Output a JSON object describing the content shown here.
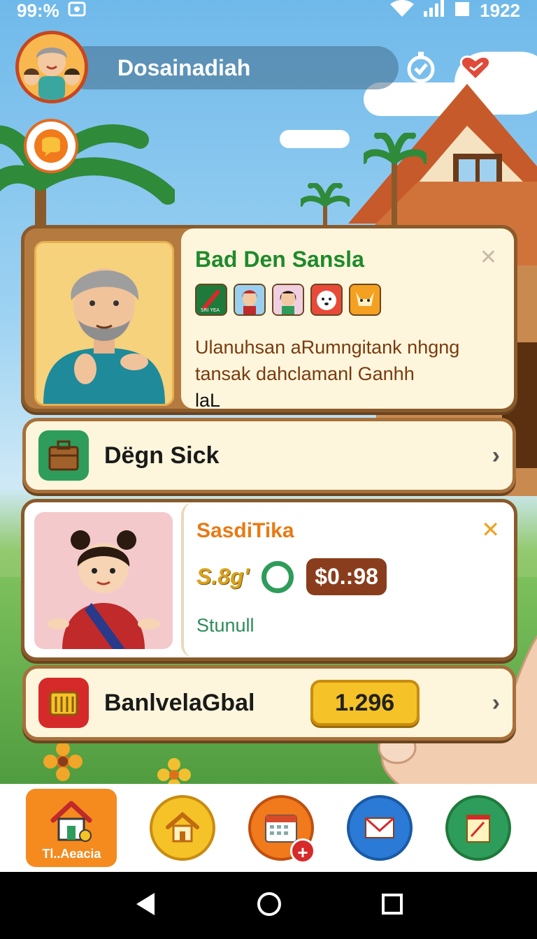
{
  "status_bar": {
    "battery": "99:%",
    "time": "1922"
  },
  "header": {
    "username": "Dosainadiah"
  },
  "card_one": {
    "title": "Bad Den Sansla",
    "description_line1": "Ulanuhsan aRumngitank nhgng",
    "description_line2": "tansak dahclamanl Ganhh",
    "description_line3": "laL",
    "chips": [
      "chip-paint-icon",
      "chip-woman-red-icon",
      "chip-woman-green-icon",
      "chip-dog-icon",
      "chip-fox-icon"
    ],
    "chip_text": "SRI YEA"
  },
  "row_two": {
    "label": "Dëgn Sick"
  },
  "card_three": {
    "title": "SasdiTika",
    "stat": "S.8g'",
    "price": "$0.:98",
    "subtitle": "Stunull"
  },
  "row_four": {
    "label": "BanlvelaGbal",
    "value": "1.296"
  },
  "bottom_nav": {
    "active_label": "Tl..Aeacia",
    "items": [
      "home-house-icon",
      "home-icon",
      "calendar-icon",
      "mail-icon",
      "notes-icon"
    ]
  },
  "colors": {
    "accent_orange": "#f58a1f",
    "title_green": "#1f8a2c",
    "title_orange": "#e87a14",
    "brown_border": "#8a5a2b",
    "price_bg": "#8a3d1c",
    "gold": "#f5c228"
  }
}
